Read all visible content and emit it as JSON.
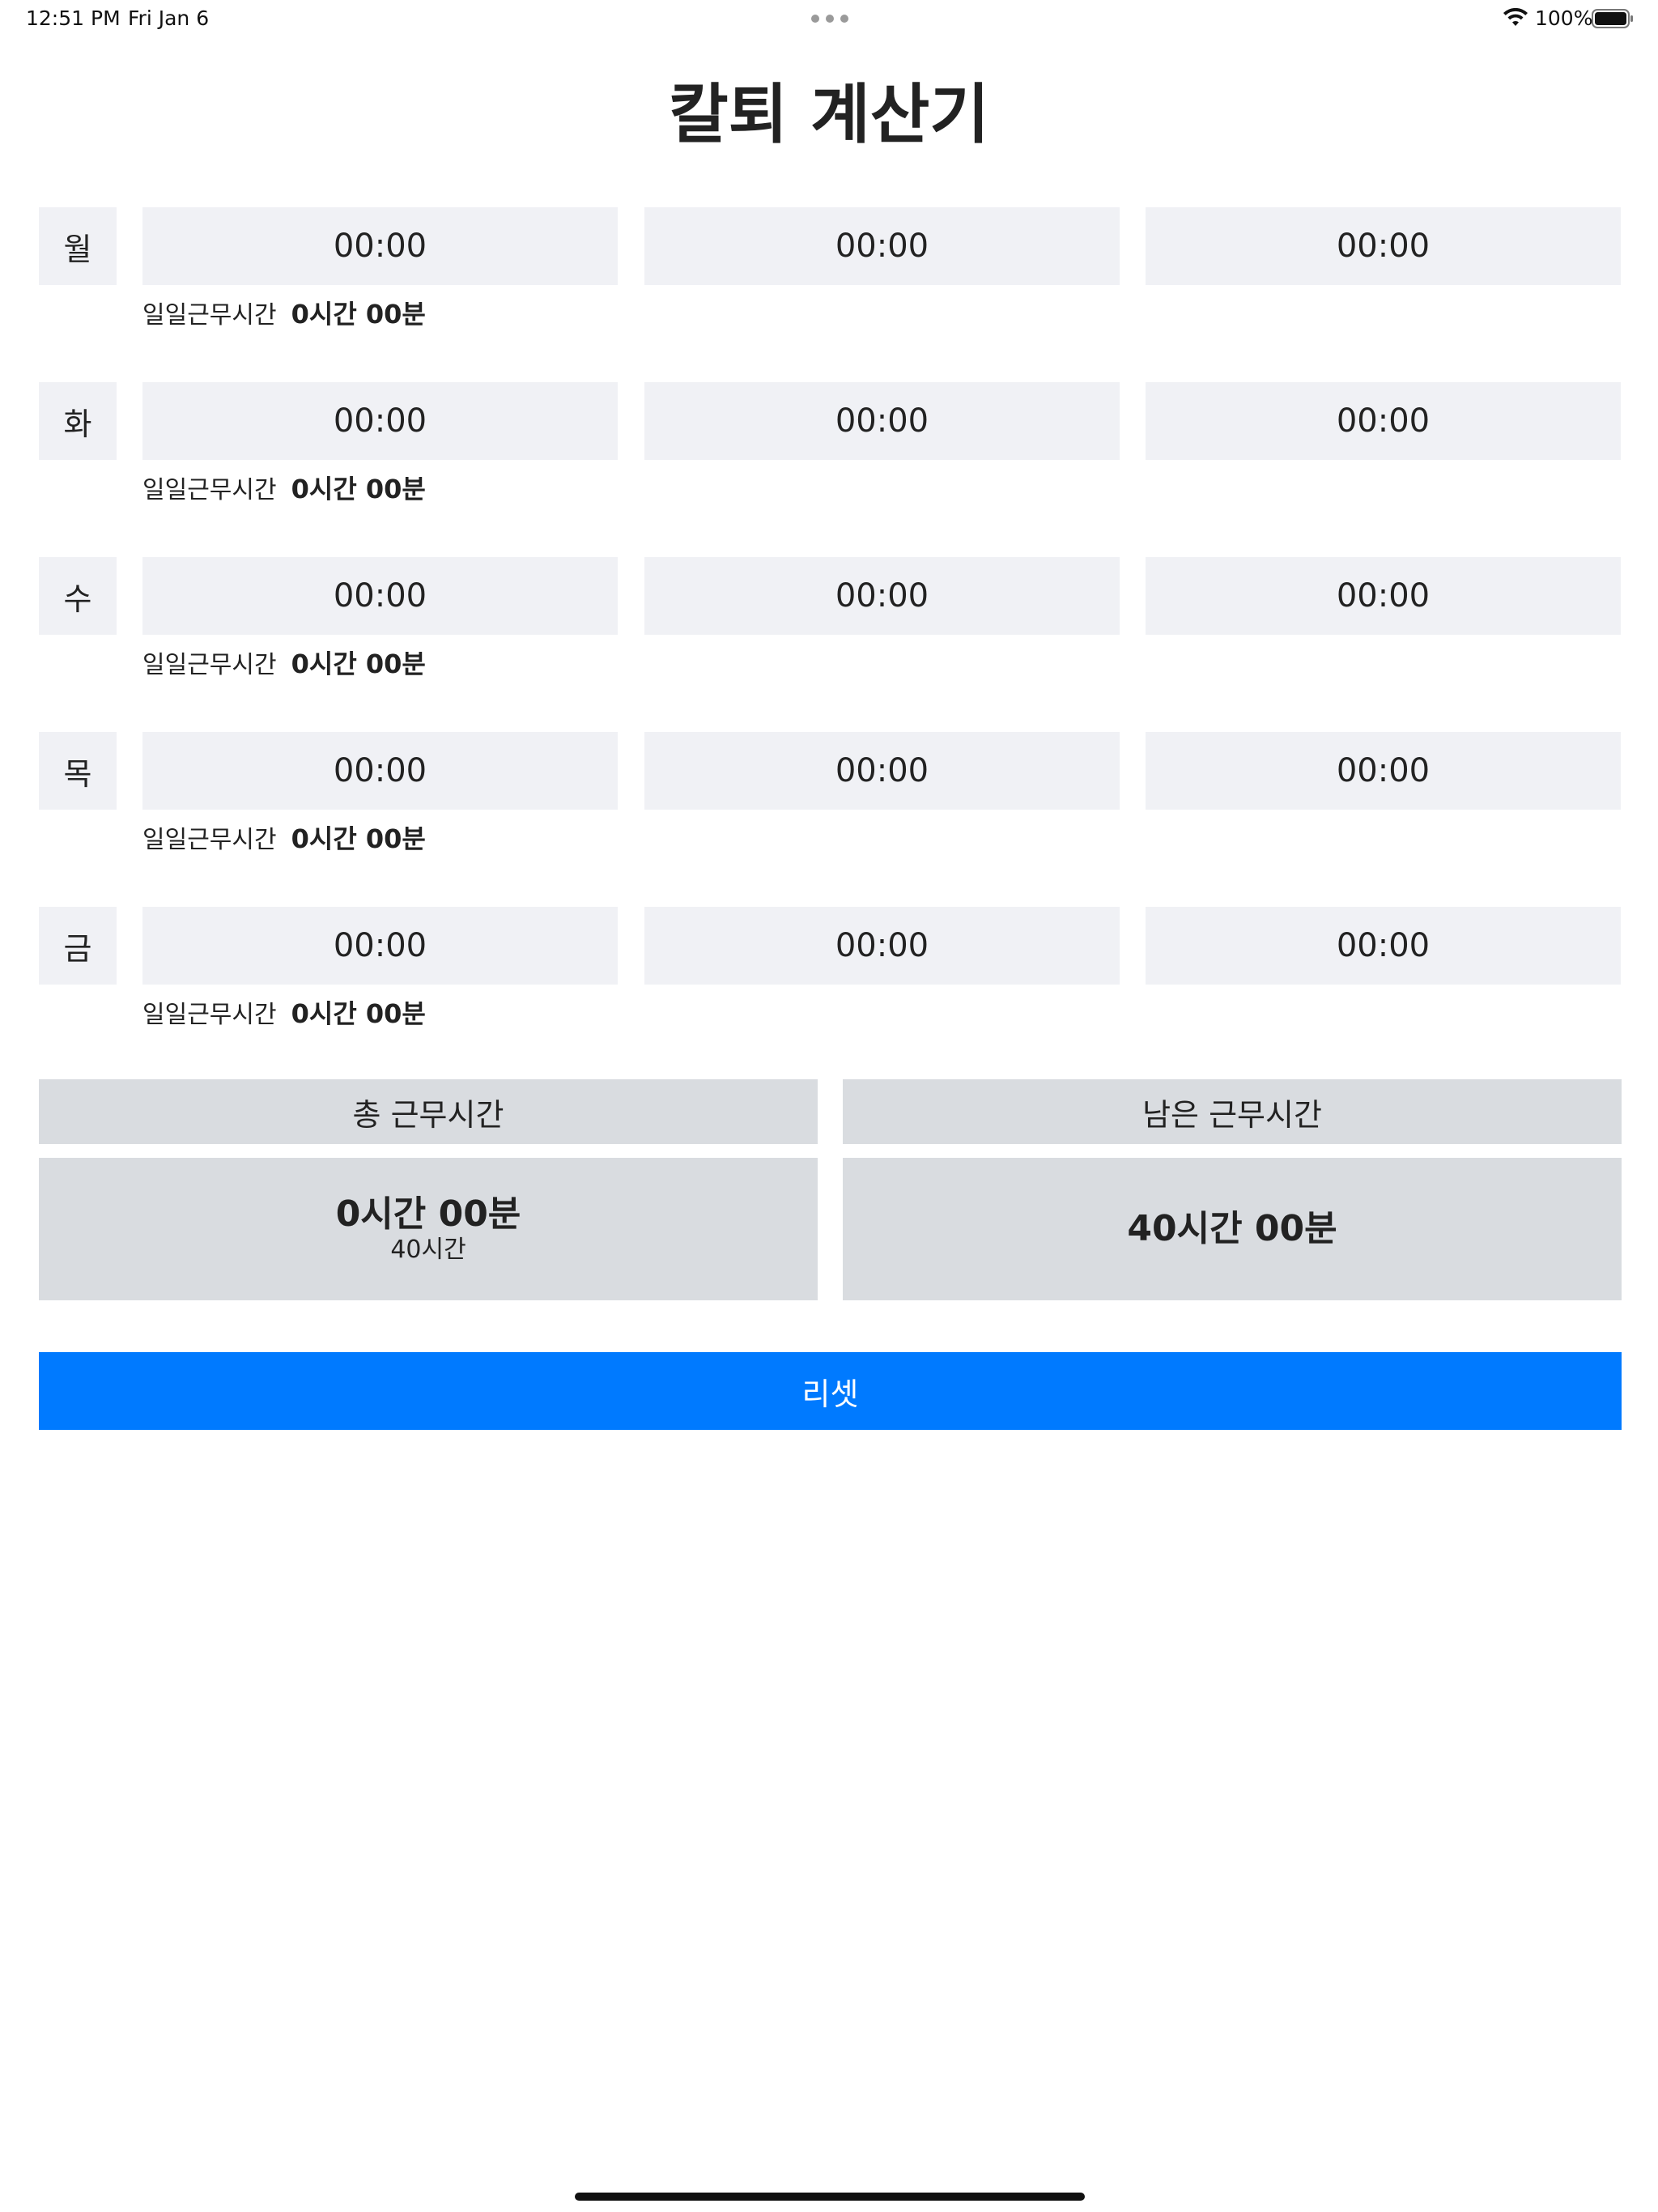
{
  "status_bar": {
    "time": "12:51 PM",
    "date": "Fri Jan 6",
    "battery": "100%"
  },
  "title": "칼퇴 계산기",
  "days": [
    {
      "label": "월",
      "times": [
        "00:00",
        "00:00",
        "00:00"
      ],
      "daily_label": "일일근무시간",
      "daily_value": "0시간 00분"
    },
    {
      "label": "화",
      "times": [
        "00:00",
        "00:00",
        "00:00"
      ],
      "daily_label": "일일근무시간",
      "daily_value": "0시간 00분"
    },
    {
      "label": "수",
      "times": [
        "00:00",
        "00:00",
        "00:00"
      ],
      "daily_label": "일일근무시간",
      "daily_value": "0시간 00분"
    },
    {
      "label": "목",
      "times": [
        "00:00",
        "00:00",
        "00:00"
      ],
      "daily_label": "일일근무시간",
      "daily_value": "0시간 00분"
    },
    {
      "label": "금",
      "times": [
        "00:00",
        "00:00",
        "00:00"
      ],
      "daily_label": "일일근무시간",
      "daily_value": "0시간 00분"
    }
  ],
  "summary": {
    "total_label": "총 근무시간",
    "total_value": "0시간 00분",
    "total_target": "40시간",
    "remaining_label": "남은 근무시간",
    "remaining_value": "40시간 00분"
  },
  "reset_label": "리셋",
  "colors": {
    "field_bg": "#f0f1f5",
    "summary_bg": "#d9dce0",
    "accent": "#007aff"
  },
  "icons": {
    "wifi": "wifi-icon",
    "battery": "battery-icon"
  }
}
